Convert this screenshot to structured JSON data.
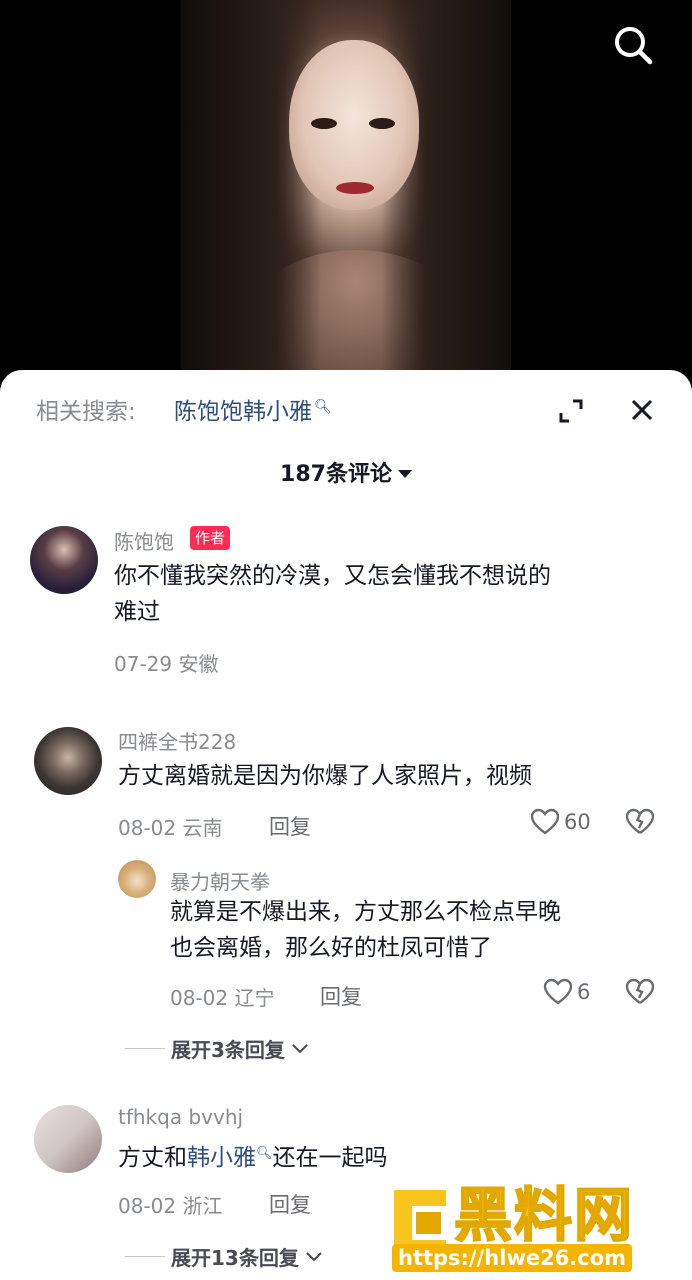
{
  "related": {
    "prefix": "相关搜索:",
    "term": "陈饱饱韩小雅"
  },
  "comment_count": "187条评论",
  "comments": [
    {
      "user": "陈饱饱",
      "tag": "作者",
      "text_line1": "你不懂我突然的冷漠，又怎会懂我不想说的",
      "text_line2": "难过",
      "meta": "07-29 安徽"
    },
    {
      "user": "四裤全书228",
      "text": "方丈离婚就是因为你爆了人家照片，视频",
      "meta": "08-02 云南",
      "reply_label": "回复",
      "likes": "60",
      "replies": [
        {
          "user": "暴力朝天拳",
          "text_line1": "就算是不爆出来，方丈那么不检点早晚",
          "text_line2": "也会离婚，那么好的杜凤可惜了",
          "meta": "08-02 辽宁",
          "reply_label": "回复",
          "likes": "6"
        }
      ],
      "expand_label": "展开3条回复"
    },
    {
      "user": "tfhkqa bvvhj",
      "text_before": "方丈和",
      "text_link": "韩小雅",
      "text_after": "还在一起吗",
      "meta": "08-02 浙江",
      "reply_label": "回复",
      "expand_label": "展开13条回复"
    }
  ],
  "watermark": {
    "title": "黑料网",
    "url": "https://hlwe26.com"
  },
  "icons": [
    "search-icon",
    "expand-icon",
    "close-icon",
    "heart-icon",
    "broken-heart-icon",
    "chevron-down-icon",
    "magnifier-icon"
  ],
  "colors": {
    "link": "#2f4f7f",
    "author_tag": "#fe2c55",
    "watermark": "#f7c51e"
  }
}
